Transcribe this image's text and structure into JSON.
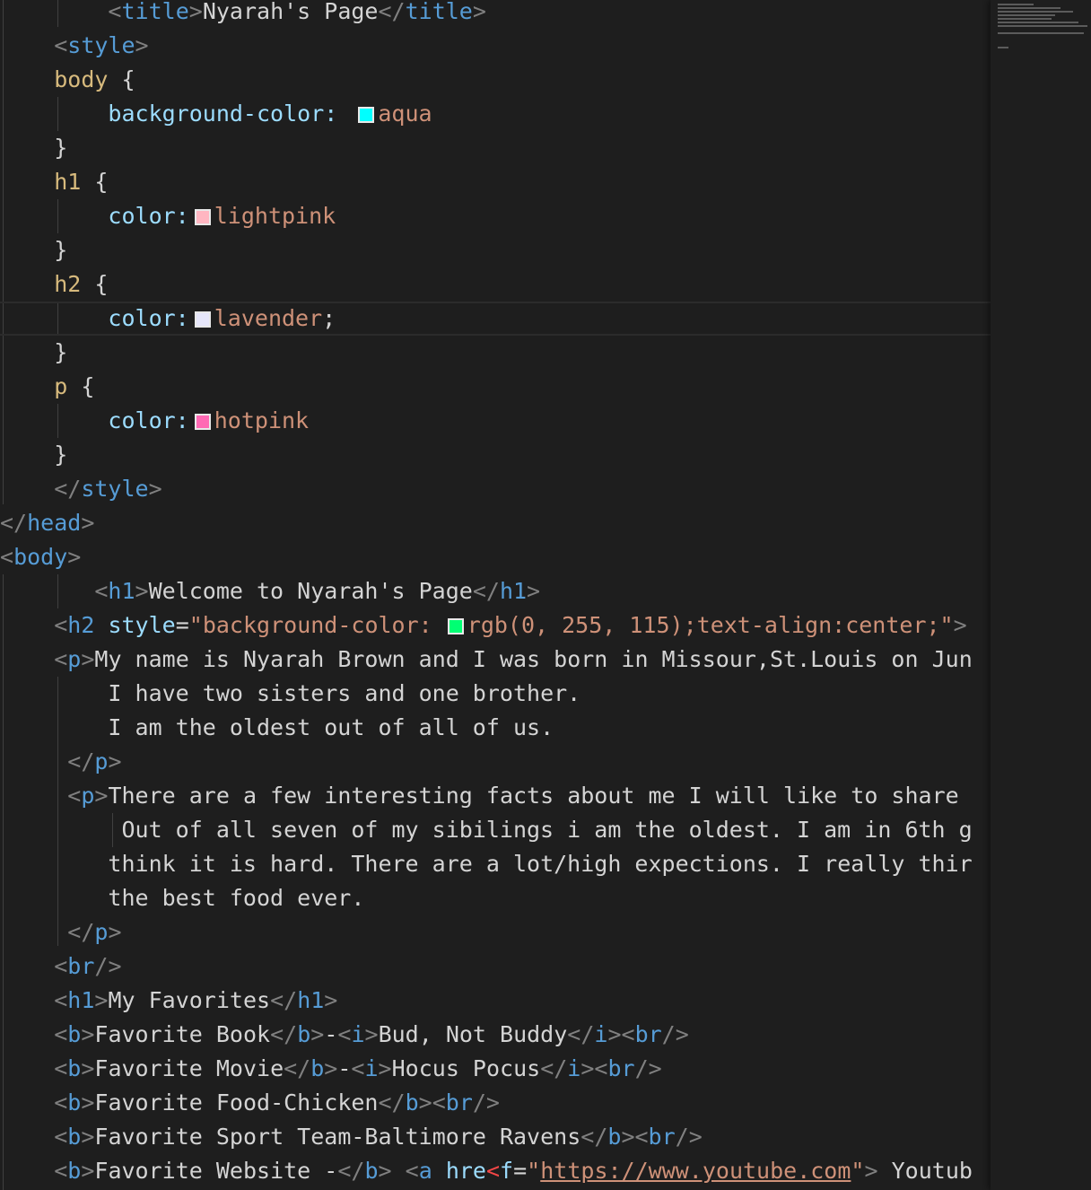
{
  "colors": {
    "aqua": "#00ffff",
    "lightpink": "#ffb6c1",
    "lavender": "#e6e6fa",
    "hotpink": "#ff69b4",
    "green": "#00ff73"
  },
  "code": {
    "title_text": "Nyarah's Page",
    "sel_body": "body",
    "prop_bg": "background-color:",
    "val_aqua": "aqua",
    "sel_h1": "h1",
    "prop_color": "color:",
    "val_lightpink": "lightpink",
    "sel_h2": "h2",
    "val_lavender": "lavender",
    "sel_p": "p",
    "val_hotpink": "hotpink",
    "tag_title": "title",
    "tag_style": "style",
    "tag_head": "head",
    "tag_body": "body",
    "tag_h1": "h1",
    "tag_h2": "h2",
    "tag_p": "p",
    "tag_br": "br",
    "tag_b": "b",
    "tag_i": "i",
    "tag_a": "a",
    "h1_welcome": "Welcome to Nyarah's Page",
    "attr_style": "style",
    "h2_style_start": "\"background-color: ",
    "h2_style_rest": "rgb(0, 255, 115);text-align:center;\"",
    "p1_line1": "My name is Nyarah Brown and I was born in Missour,St.Louis on Jun",
    "p1_line2": "I have two sisters and one brother.",
    "p1_line3": "I am the oldest out of all of us.",
    "p2_line1": "There are a few interesting facts about me I will like to share",
    "p2_line2": "Out of all seven of my sibilings i am the oldest. I am in 6th g",
    "p2_line3": "think it is hard. There are a lot/high expections. I really thir",
    "p2_line4": "the best food ever.",
    "h1_favorites": "My Favorites",
    "fav_book_label": "Favorite Book",
    "fav_book_value": "Bud, Not Buddy",
    "fav_movie_label": "Favorite Movie",
    "fav_movie_value": "Hocus Pocus",
    "fav_food": "Favorite Food-Chicken",
    "fav_team": "Favorite Sport Team-Baltimore Ravens",
    "fav_site_label": "Favorite Website -",
    "attr_href_a": "hre",
    "attr_href_err": "<",
    "attr_href_b": "f",
    "href_url": "https://www.youtube.com",
    "link_text": "Youtub"
  }
}
